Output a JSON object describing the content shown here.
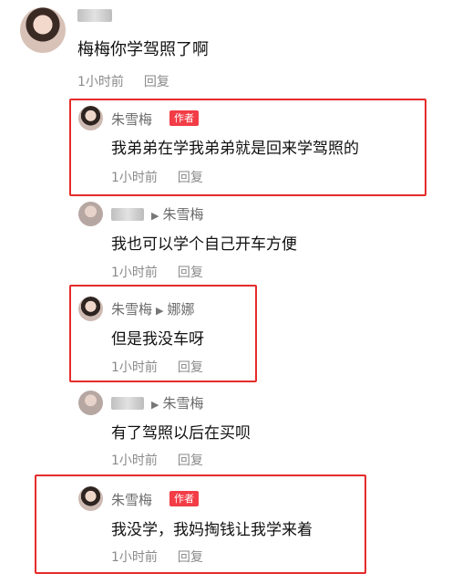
{
  "comments": [
    {
      "text": "梅梅你学驾照了啊",
      "time": "1小时前",
      "reply": "回复"
    },
    {
      "name": "朱雪梅",
      "tag": "作者",
      "text": "我弟弟在学我弟弟就是回来学驾照的",
      "time": "1小时前",
      "reply": "回复"
    },
    {
      "reply_to": "朱雪梅",
      "text": "我也可以学个自己开车方便",
      "time": "1小时前",
      "reply": "回复"
    },
    {
      "name": "朱雪梅",
      "reply_to": "娜娜",
      "text": "但是我没车呀",
      "time": "1小时前",
      "reply": "回复"
    },
    {
      "reply_to": "朱雪梅",
      "text": "有了驾照以后在买呗",
      "time": "1小时前",
      "reply": "回复"
    },
    {
      "name": "朱雪梅",
      "tag": "作者",
      "text": "我没学，我妈掏钱让我学来着",
      "time": "1小时前",
      "reply": "回复"
    }
  ]
}
